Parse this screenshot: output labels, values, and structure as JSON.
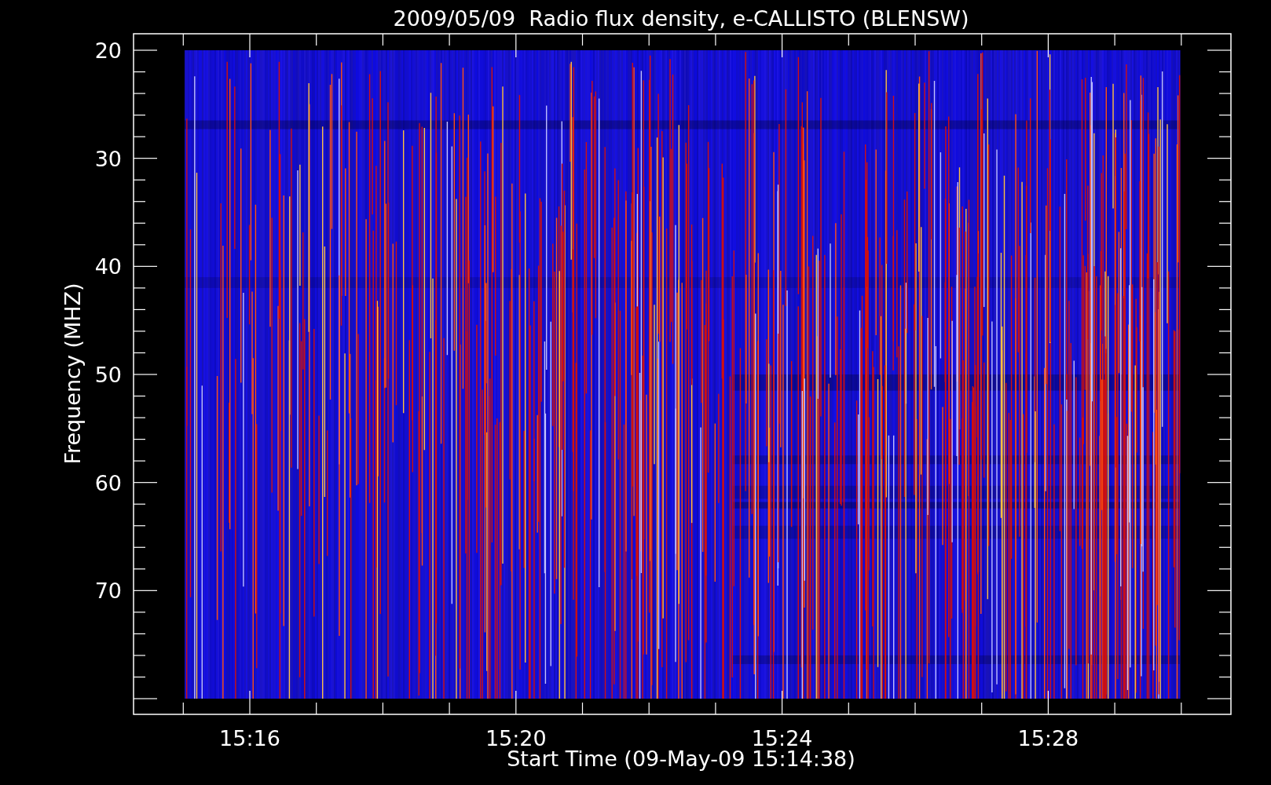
{
  "plot": {
    "title": "2009/05/09  Radio flux density, e-CALLISTO (BLENSW)",
    "xlabel": "Start Time (09-May-09 15:14:38)",
    "ylabel": "Frequency (MHZ)",
    "xticks": [
      "15:16",
      "15:20",
      "15:24",
      "15:28"
    ],
    "yticks": [
      "20",
      "30",
      "40",
      "50",
      "60",
      "70"
    ]
  }
}
